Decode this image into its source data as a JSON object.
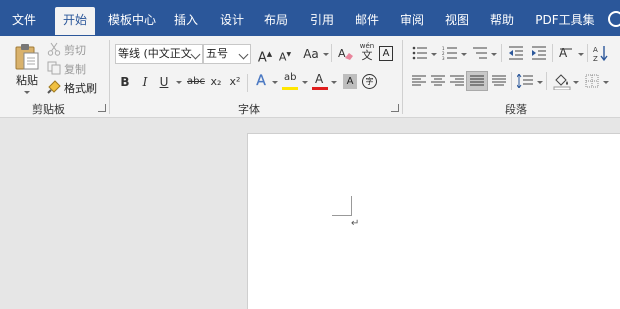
{
  "tabs": [
    "文件",
    "开始",
    "模板中心",
    "插入",
    "设计",
    "布局",
    "引用",
    "邮件",
    "审阅",
    "视图",
    "帮助",
    "PDF工具集"
  ],
  "active_tab": "开始",
  "clipboard": {
    "paste_label": "粘贴",
    "cut_label": "剪切",
    "copy_label": "复制",
    "format_painter_label": "格式刷",
    "group_label": "剪贴板"
  },
  "font": {
    "font_name": "等线 (中文正文",
    "font_size": "五号",
    "grow_label": "A",
    "shrink_label": "A",
    "change_case_label": "Aa",
    "pinyin_label": "wén",
    "pinyin_sub": "文",
    "border_char_label": "A",
    "bold": "B",
    "italic": "I",
    "underline": "U",
    "strike": "abc",
    "subscript": "x₂",
    "superscript": "x²",
    "text_effect": "A",
    "highlight": "ab",
    "font_color": "A",
    "char_shading": "A",
    "enclose": "字",
    "group_label": "字体"
  },
  "paragraph": {
    "group_label": "段落",
    "sort_label": "A↓Z"
  },
  "document": {
    "paragraph_mark": "↵"
  },
  "colors": {
    "accent": "#2b579a",
    "highlight": "#ffe600",
    "font_color": "#e01e1e"
  }
}
